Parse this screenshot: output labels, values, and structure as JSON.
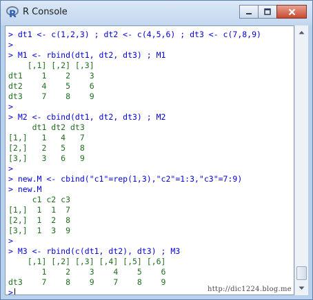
{
  "window": {
    "title": "R Console"
  },
  "app_icon": "r-logo-icon",
  "controls": [
    "minimize-icon",
    "maximize-icon",
    "close-icon"
  ],
  "console": {
    "lines": [
      {
        "text": "> dt1 <- c(1,2,3) ; dt2 <- c(4,5,6) ; dt3 <- c(7,8,9)",
        "kind": "in"
      },
      {
        "text": ">",
        "kind": "in"
      },
      {
        "text": "> M1 <- rbind(dt1, dt2, dt3) ; M1",
        "kind": "in"
      },
      {
        "text": "    [,1] [,2] [,3]",
        "kind": "out"
      },
      {
        "text": "dt1    1    2    3",
        "kind": "out"
      },
      {
        "text": "dt2    4    5    6",
        "kind": "out"
      },
      {
        "text": "dt3    7    8    9",
        "kind": "out"
      },
      {
        "text": ">",
        "kind": "in"
      },
      {
        "text": "> M2 <- cbind(dt1, dt2, dt3) ; M2",
        "kind": "in"
      },
      {
        "text": "     dt1 dt2 dt3",
        "kind": "out"
      },
      {
        "text": "[1,]   1   4   7",
        "kind": "out"
      },
      {
        "text": "[2,]   2   5   8",
        "kind": "out"
      },
      {
        "text": "[3,]   3   6   9",
        "kind": "out"
      },
      {
        "text": ">",
        "kind": "in"
      },
      {
        "text": "> new.M <- cbind(\"c1\"=rep(1,3),\"c2\"=1:3,\"c3\"=7:9)",
        "kind": "in"
      },
      {
        "text": "> new.M",
        "kind": "in"
      },
      {
        "text": "     c1 c2 c3",
        "kind": "out"
      },
      {
        "text": "[1,]  1  1  7",
        "kind": "out"
      },
      {
        "text": "[2,]  1  2  8",
        "kind": "out"
      },
      {
        "text": "[3,]  1  3  9",
        "kind": "out"
      },
      {
        "text": ">",
        "kind": "in"
      },
      {
        "text": "> M3 <- rbind(c(dt1, dt2), dt3) ; M3",
        "kind": "in"
      },
      {
        "text": "    [,1] [,2] [,3] [,4] [,5] [,6]",
        "kind": "out"
      },
      {
        "text": "       1    2    3    4    5    6",
        "kind": "out"
      },
      {
        "text": "dt3    7    8    9    7    8    9",
        "kind": "out"
      }
    ],
    "prompt": ">"
  },
  "watermark": "http://dic1224.blog.me",
  "colors": {
    "input": "#0000dd",
    "output": "#1f6e1f"
  }
}
